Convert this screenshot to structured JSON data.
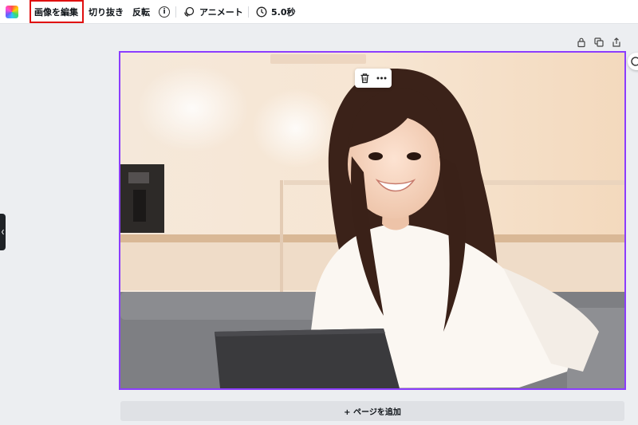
{
  "toolbar": {
    "edit_image": "画像を編集",
    "crop": "切り抜き",
    "flip": "反転",
    "info_symbol": "i",
    "animate": "アニメート",
    "duration": "5.0秒"
  },
  "icons": {
    "palette": "color-palette-icon",
    "animate": "animate-icon",
    "clock": "clock-icon",
    "lock": "lock-icon",
    "duplicate": "duplicate-icon",
    "share": "share-icon",
    "trash": "trash-icon",
    "more": "more-icon"
  },
  "colors": {
    "selection": "#8b3dff",
    "highlight": "#e01010"
  },
  "footer": {
    "add_page": "+ ページを追加"
  }
}
